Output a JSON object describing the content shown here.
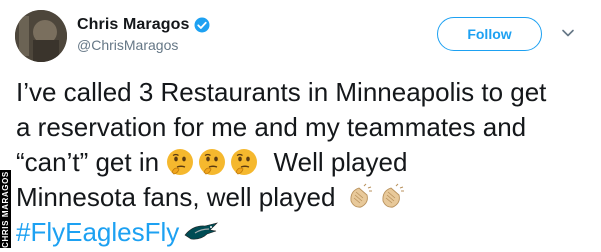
{
  "user": {
    "display_name": "Chris Maragos",
    "handle": "@ChrisMaragos",
    "verified": true
  },
  "follow_button": {
    "label": "Follow"
  },
  "tweet": {
    "lines": [
      "I’ve called 3 Restaurants in Minneapolis to get",
      "a reservation for me and my teammates and",
      "“can’t” get in",
      "Well played",
      "Minnesota fans, well played",
      "#FlyEaglesFly"
    ],
    "emojis": [
      "thinking-face",
      "thinking-face",
      "thinking-face",
      "clapping-hands",
      "clapping-hands",
      "eagles-logo"
    ]
  },
  "photo_credit": "CHRIS MARAGOS",
  "colors": {
    "accent": "#1da1f2",
    "text": "#14171a",
    "muted": "#657786"
  }
}
